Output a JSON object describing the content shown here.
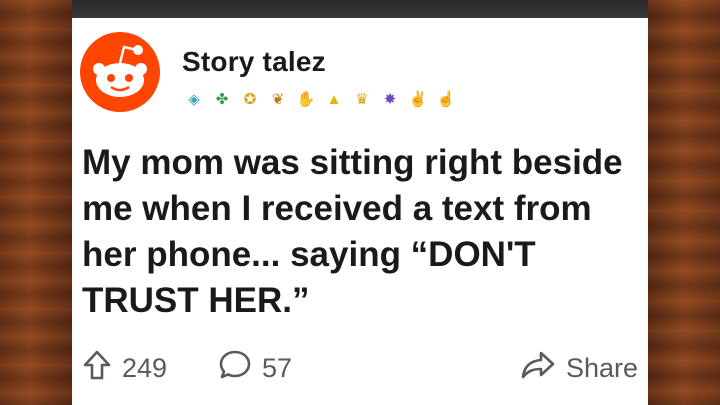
{
  "post": {
    "username": "Story talez",
    "title": "My mom was sitting right beside me when I received a text from her phone... saying “DON'T TRUST HER.”",
    "upvotes": "249",
    "comments": "57",
    "share_label": "Share"
  },
  "badges": [
    {
      "icon": "diamond-badge-icon",
      "glyph": "◈",
      "color": "#3aa6b9"
    },
    {
      "icon": "clover-badge-icon",
      "glyph": "✤",
      "color": "#3e9b4f"
    },
    {
      "icon": "star-badge-icon",
      "glyph": "✪",
      "color": "#d8a21a"
    },
    {
      "icon": "leaf-badge-icon",
      "glyph": "❦",
      "color": "#c77a1c"
    },
    {
      "icon": "hand-badge-icon",
      "glyph": "✋",
      "color": "#8a8a8a"
    },
    {
      "icon": "arrow-badge-icon",
      "glyph": "▲",
      "color": "#e6b400"
    },
    {
      "icon": "trophy-badge-icon",
      "glyph": "♛",
      "color": "#d6a51a"
    },
    {
      "icon": "number-one-badge-icon",
      "glyph": "✸",
      "color": "#6a4bc4"
    },
    {
      "icon": "clap-badge-icon",
      "glyph": "✌",
      "color": "#7a7a7a"
    },
    {
      "icon": "thumbs-up-badge-icon",
      "glyph": "☝",
      "color": "#e08a2a"
    }
  ],
  "colors": {
    "brand": "#ff4500",
    "text": "#1a1a1b",
    "muted": "#555b61"
  }
}
